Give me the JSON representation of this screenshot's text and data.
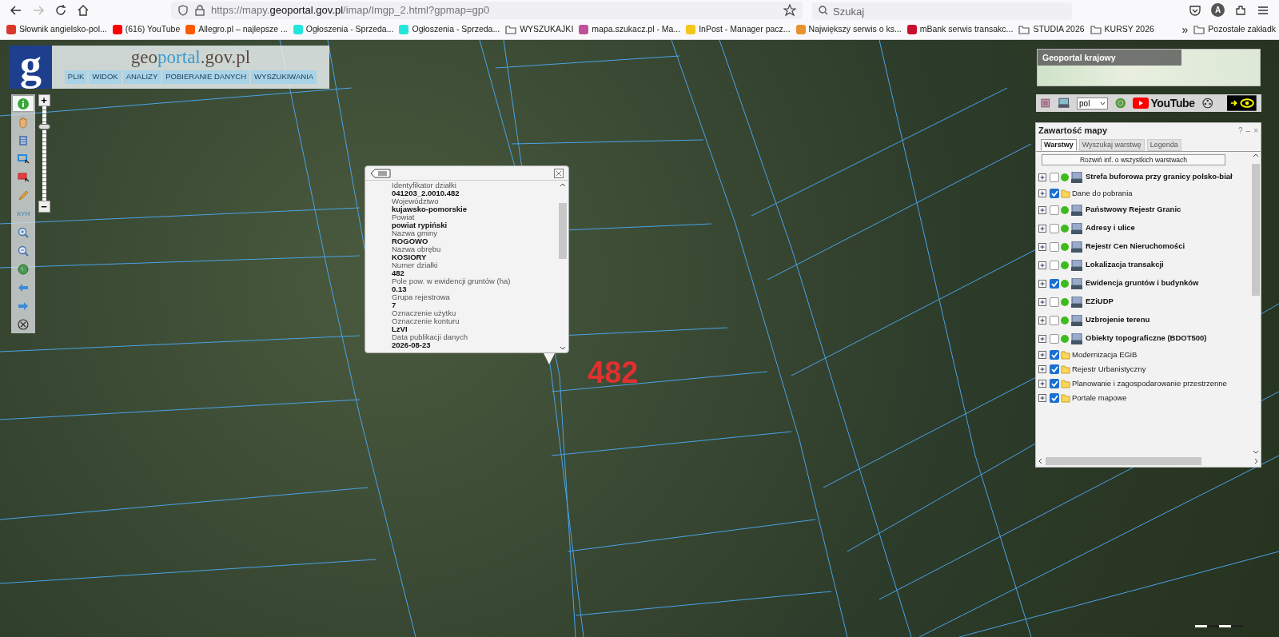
{
  "browser": {
    "forward_enabled": false,
    "url": {
      "prefix": "https://mapy.",
      "domain": "geoportal.gov.pl",
      "path": "/imap/Imgp_2.html?gpmap=gp0"
    },
    "search": {
      "placeholder": "Szukaj"
    },
    "account_initial": "A",
    "bookmarks": [
      {
        "kind": "site",
        "label": "Słownik angielsko-pol...",
        "color": "#d9382c"
      },
      {
        "kind": "site",
        "label": "(616) YouTube",
        "color": "#ff0000"
      },
      {
        "kind": "site",
        "label": "Allegro.pl – najlepsze ...",
        "color": "#ff5a00"
      },
      {
        "kind": "site",
        "label": "Ogłoszenia - Sprzeda...",
        "color": "#23e5db"
      },
      {
        "kind": "site",
        "label": "Ogłoszenia - Sprzeda...",
        "color": "#23e5db"
      },
      {
        "kind": "folder",
        "label": "WYSZUKAJKI"
      },
      {
        "kind": "site",
        "label": "mapa.szukacz.pl - Ma...",
        "color": "#c0509c"
      },
      {
        "kind": "site",
        "label": "InPost - Manager pacz...",
        "color": "#f5c518"
      },
      {
        "kind": "site",
        "label": "Największy serwis o ks...",
        "color": "#e8912d"
      },
      {
        "kind": "site",
        "label": "mBank serwis transakc...",
        "color": "#c8102e"
      },
      {
        "kind": "folder",
        "label": "STUDIA 2026"
      },
      {
        "kind": "folder",
        "label": "KURSY 2026"
      }
    ],
    "overflow": "»",
    "other_bookmarks": "Pozostałe zakładk"
  },
  "header": {
    "logo_letter": "g",
    "title_prefix": "geo",
    "title_highlight": "portal",
    "title_suffix": ".gov.pl",
    "menu": [
      "PLIK",
      "WIDOK",
      "ANALIZY",
      "POBIERANIE DANYCH",
      "WYSZUKIWANIA"
    ]
  },
  "tools": [
    {
      "kind": "info",
      "selected": true
    },
    {
      "kind": "pan",
      "selected": false
    },
    {
      "kind": "table",
      "selected": false
    },
    {
      "kind": "select",
      "selected": false
    },
    {
      "kind": "select-red",
      "selected": false
    },
    {
      "kind": "pencil",
      "selected": false
    },
    {
      "kind": "coords",
      "label": "XYH",
      "selected": false
    },
    {
      "kind": "zoom-in",
      "selected": false
    },
    {
      "kind": "zoom-out",
      "selected": false
    },
    {
      "kind": "globe",
      "selected": false
    },
    {
      "kind": "back",
      "selected": false
    },
    {
      "kind": "forward",
      "selected": false
    },
    {
      "kind": "reset",
      "selected": false
    }
  ],
  "zoom": {
    "plus": "+",
    "minus": "−",
    "level": 0.8
  },
  "popup": {
    "fields": [
      {
        "label": "Identyfikator działki",
        "value": "041203_2.0010.482"
      },
      {
        "label": "Województwo",
        "value": "kujawsko-pomorskie"
      },
      {
        "label": "Powiat",
        "value": "powiat rypiński"
      },
      {
        "label": "Nazwa gminy",
        "value": "ROGOWO"
      },
      {
        "label": "Nazwa obrębu",
        "value": "KOSIORY"
      },
      {
        "label": "Numer działki",
        "value": "482"
      },
      {
        "label": "Pole pow. w ewidencji gruntów (ha)",
        "value": "0.13"
      },
      {
        "label": "Grupa rejestrowa",
        "value": "7"
      },
      {
        "label": "Oznaczenie użytku"
      },
      {
        "label": "Oznaczenie konturu",
        "value": "LzVI"
      },
      {
        "label": "Data publikacji danych",
        "value": "2026-08-23"
      }
    ]
  },
  "map_label": "482",
  "overview": {
    "title": "Geoportal krajowy"
  },
  "toolbar": {
    "language": "pol",
    "video_label": "YouTube"
  },
  "layers_panel": {
    "title": "Zawartość mapy",
    "window_controls": [
      "?",
      "–",
      "×"
    ],
    "tabs": [
      {
        "label": "Warstwy",
        "selected": true
      },
      {
        "label": "Wyszukaj warstwę",
        "selected": false
      },
      {
        "label": "Legenda",
        "selected": false
      }
    ],
    "expand_button": "Rozwiń inf. o wszystkich warstwach",
    "layers": [
      {
        "kind": "wms",
        "name": "Strefa buforowa przy granicy polsko-biał",
        "checked": false
      },
      {
        "kind": "folder",
        "name": "Dane do pobrania",
        "checked": true
      },
      {
        "kind": "wms",
        "name": "Państwowy Rejestr Granic",
        "checked": false
      },
      {
        "kind": "wms",
        "name": "Adresy i ulice",
        "checked": false
      },
      {
        "kind": "wms",
        "name": "Rejestr Cen Nieruchomości",
        "checked": false
      },
      {
        "kind": "wms",
        "name": "Lokalizacja transakcji",
        "checked": false
      },
      {
        "kind": "wms",
        "name": "Ewidencja gruntów i budynków",
        "checked": true
      },
      {
        "kind": "wms",
        "name": "EZiUDP",
        "checked": false
      },
      {
        "kind": "wms",
        "name": "Uzbrojenie terenu",
        "checked": false
      },
      {
        "kind": "wms",
        "name": "Obiekty topograficzne (BDOT500)",
        "checked": false
      },
      {
        "kind": "folder",
        "name": "Modernizacja EGiB",
        "checked": true
      },
      {
        "kind": "folder",
        "name": "Rejestr Urbanistyczny",
        "checked": true
      },
      {
        "kind": "folder",
        "name": "Planowanie i zagospodarowanie przestrzenne",
        "checked": true
      },
      {
        "kind": "folder",
        "name": "Portale mapowe",
        "checked": true
      }
    ]
  }
}
